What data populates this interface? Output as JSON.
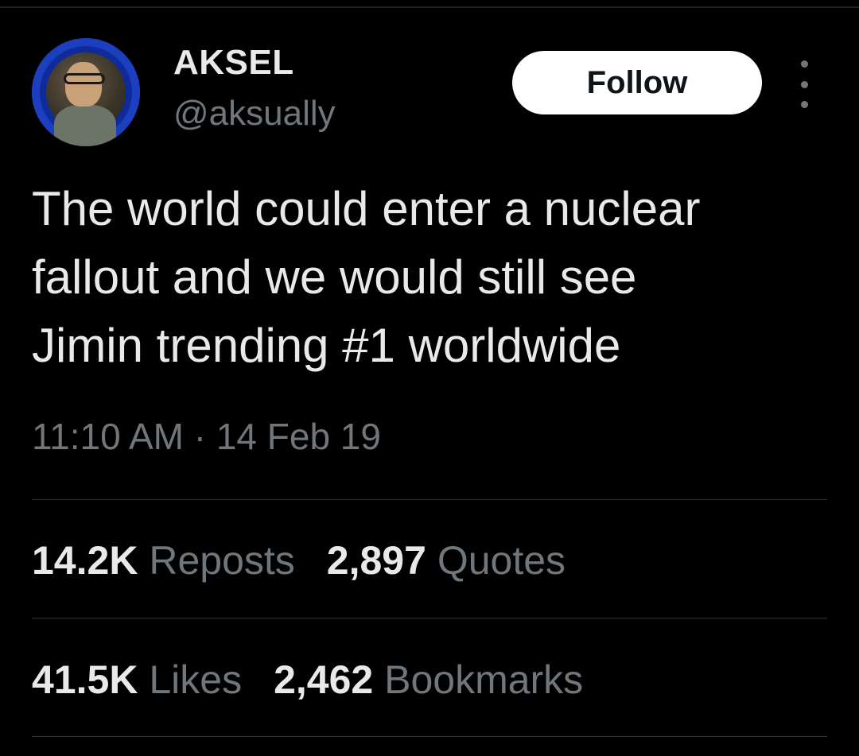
{
  "author": {
    "display_name": "AKSEL",
    "handle": "@aksually",
    "avatar_icon": "profile-photo-blue-frame"
  },
  "actions": {
    "follow_label": "Follow",
    "more_icon": "vertical-ellipsis-icon"
  },
  "tweet": {
    "text": "The world could enter a nuclear\nfallout and we would still see\nJimin trending #1 worldwide",
    "timestamp": "11:10 AM · 14 Feb 19"
  },
  "stats": {
    "reposts": {
      "count": "14.2K",
      "label": "Reposts"
    },
    "quotes": {
      "count": "2,897",
      "label": "Quotes"
    },
    "likes": {
      "count": "41.5K",
      "label": "Likes"
    },
    "bookmarks": {
      "count": "2,462",
      "label": "Bookmarks"
    }
  },
  "colors": {
    "background": "#000000",
    "primary_text": "#e7e9ea",
    "secondary_text": "#71767b",
    "divider": "#2f3336",
    "follow_button_bg": "#ffffff",
    "avatar_ring": "#1c3fc0"
  }
}
